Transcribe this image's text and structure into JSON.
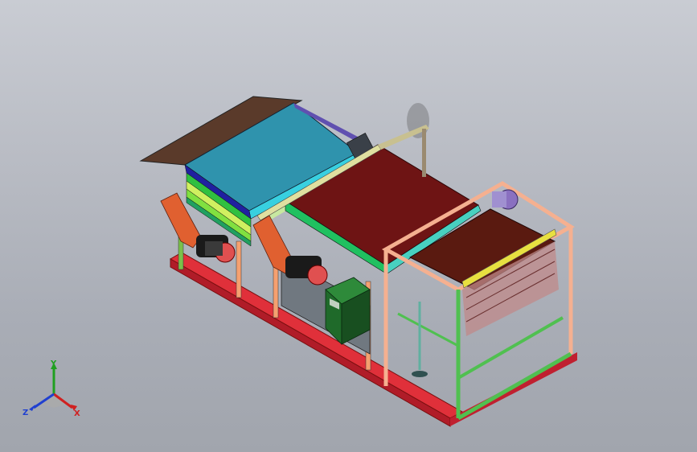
{
  "viewport": {
    "background_top": "#c9ccd3",
    "background_bottom": "#a1a5ad"
  },
  "triad": {
    "x_label": "X",
    "y_label": "Y",
    "z_label": "Z",
    "x_color": "#d02020",
    "y_color": "#20a020",
    "z_color": "#2040d0"
  },
  "model": {
    "frame_color": "#e0303a",
    "belt_top_color": "#2f93ad",
    "belt_mid_color": "#6e1414",
    "belt_right_color": "#5a1a10",
    "motor_color": "#e05050",
    "control_box_color": "#1f6a2a",
    "guard_color": "#e06030"
  }
}
